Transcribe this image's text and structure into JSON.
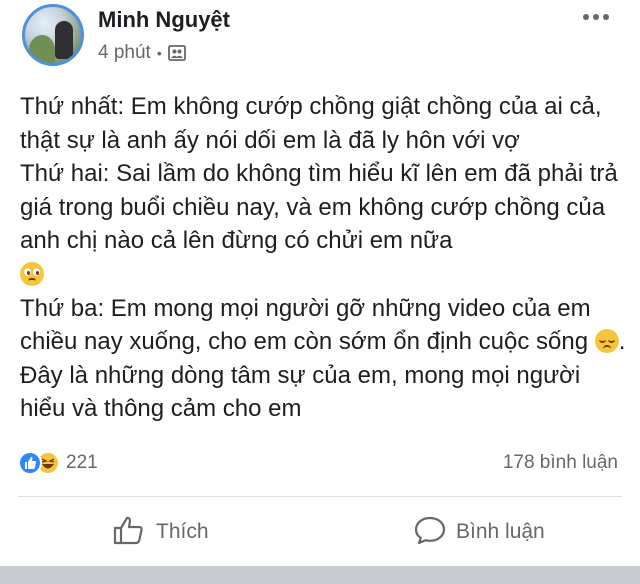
{
  "post": {
    "author": "Minh Nguyệt",
    "time": "4 phút",
    "separator": "•",
    "privacy_icon": "friends-icon",
    "paragraphs": [
      {
        "text": "Thứ nhất: Em không cướp chồng giật chồng của ai cả, thật sự là anh ấy nói dối em là đã ly hôn với vợ"
      },
      {
        "text": "Thứ hai: Sai lầm do không tìm hiểu kĩ lên em đã phải trả giá trong buổi chiều nay, và em không cướp chồng của anh chị nào cả lên đừng có chửi em nữa"
      },
      {
        "before": "Thứ ba: Em mong mọi người gỡ những video của em chiều nay xuống, cho em còn sớm ổn định cuộc sống",
        "after": ". Đây là những dòng tâm sự của em, mong mọi người hiểu và thông cảm cho em"
      }
    ],
    "emojis": [
      "pleading-face-emoji",
      "pensive-face-emoji"
    ]
  },
  "stats": {
    "reaction_icons": [
      "like-icon",
      "haha-icon"
    ],
    "reaction_count": "221",
    "comment_count": "178 bình luận"
  },
  "actions": {
    "like_label": "Thích",
    "comment_label": "Bình luận"
  },
  "colors": {
    "accent": "#2d88ff",
    "secondary_text": "#65676b",
    "divider": "#dadde1"
  }
}
